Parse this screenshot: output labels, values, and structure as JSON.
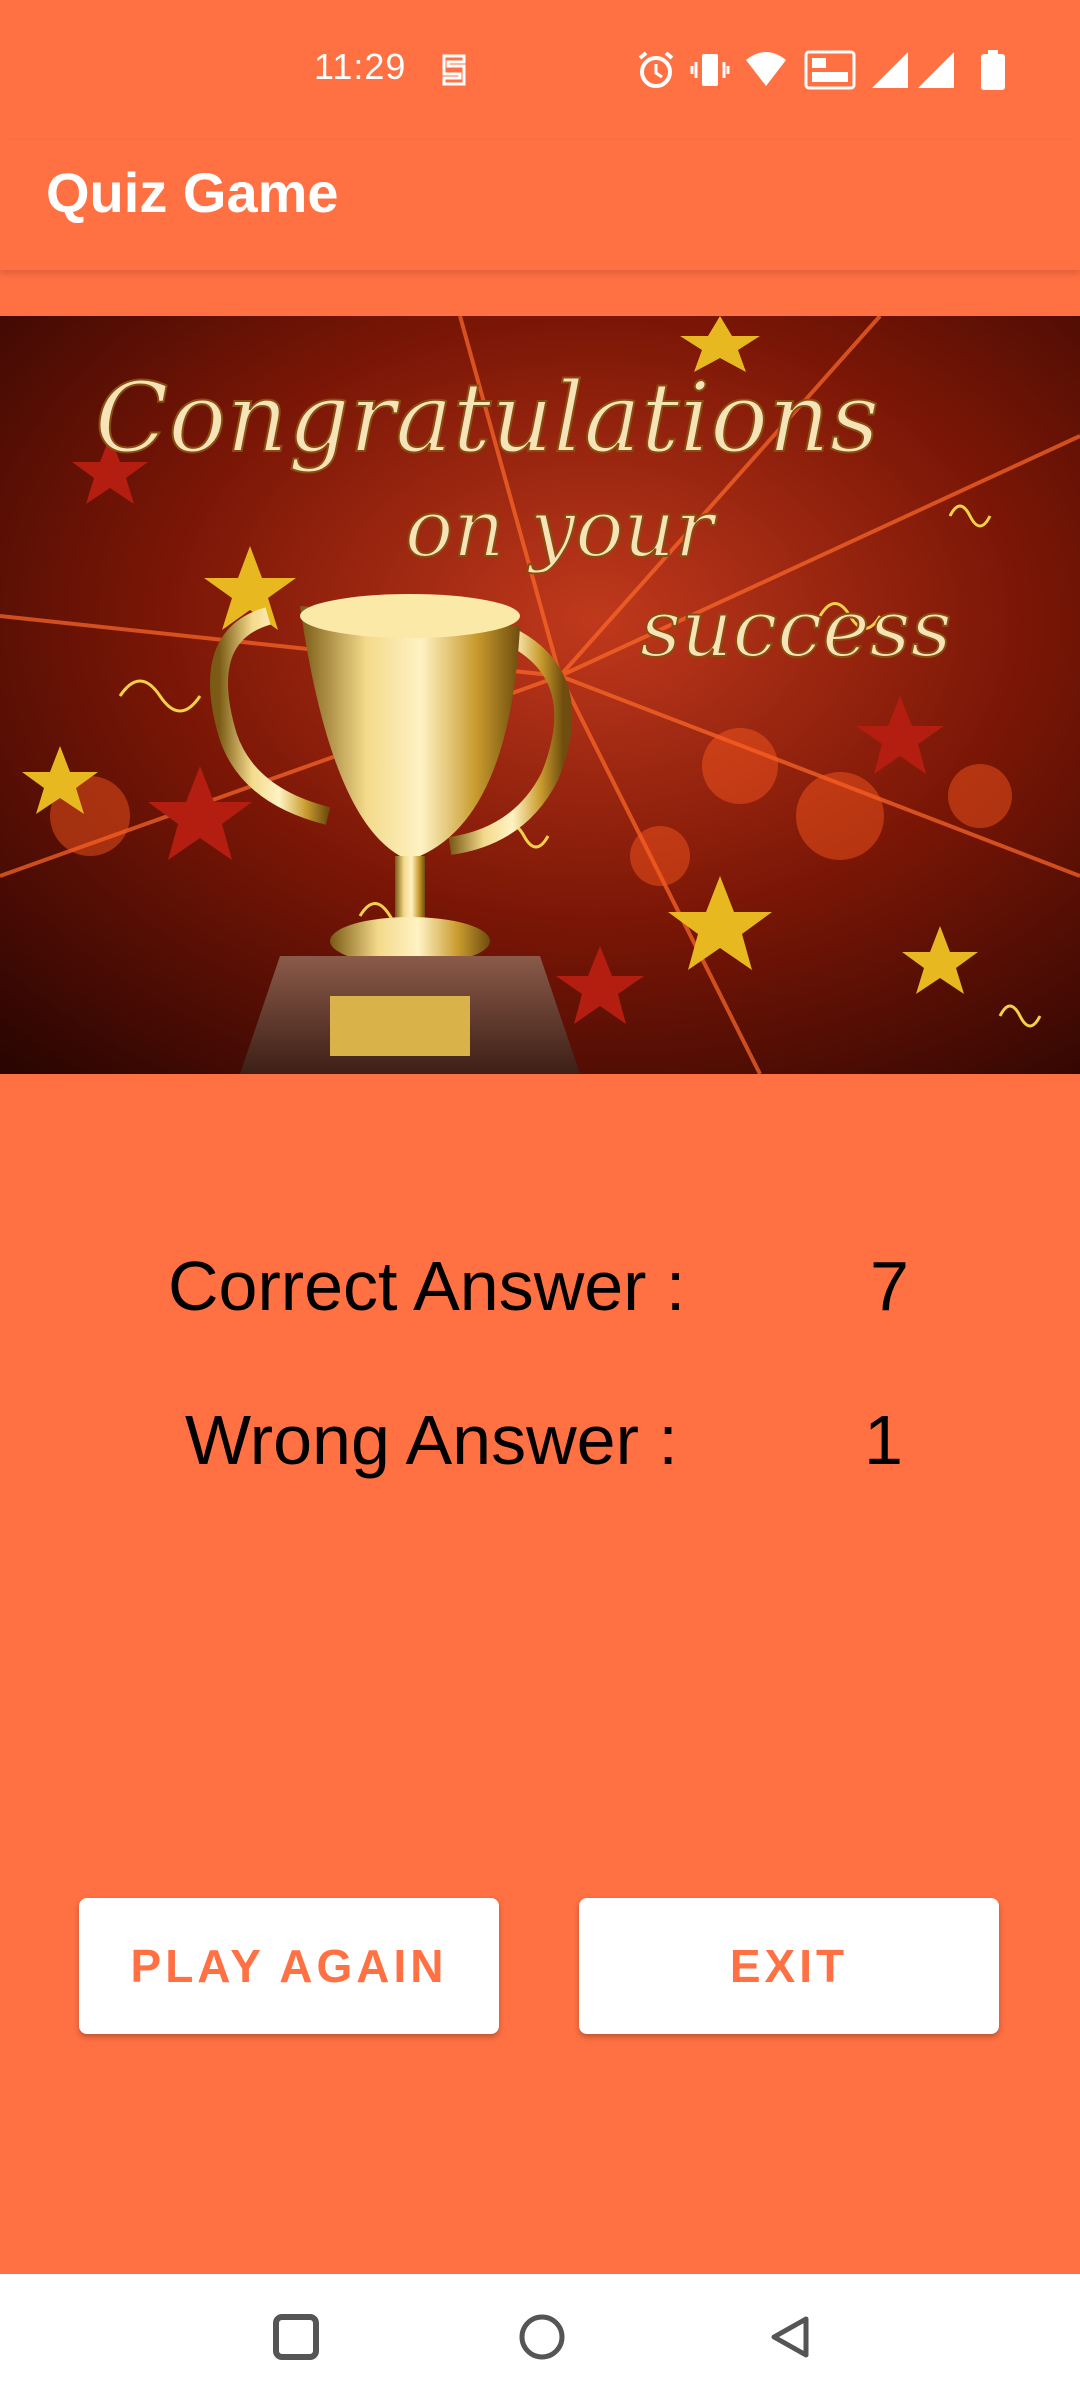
{
  "status_bar": {
    "time": "11:29",
    "icons": [
      "notification-icon",
      "alarm-icon",
      "vibrate-icon",
      "wifi-icon",
      "volte-icon",
      "signal-icon",
      "signal-icon",
      "battery-icon"
    ]
  },
  "app_bar": {
    "title": "Quiz Game"
  },
  "banner": {
    "line1": "Congratulations",
    "line2": "on your",
    "line3": "success"
  },
  "results": {
    "correct_label": "Correct Answer :",
    "correct_value": "7",
    "wrong_label": "Wrong Answer :",
    "wrong_value": "1"
  },
  "buttons": {
    "play_again": "PLAY AGAIN",
    "exit": "EXIT"
  },
  "nav_bar": {
    "icons": [
      "recents-icon",
      "home-icon",
      "back-icon"
    ]
  },
  "colors": {
    "background": "#FF7043",
    "button_bg": "#FFFFFF",
    "button_text": "#FF7043",
    "nav_bg": "#FFFFFF"
  }
}
